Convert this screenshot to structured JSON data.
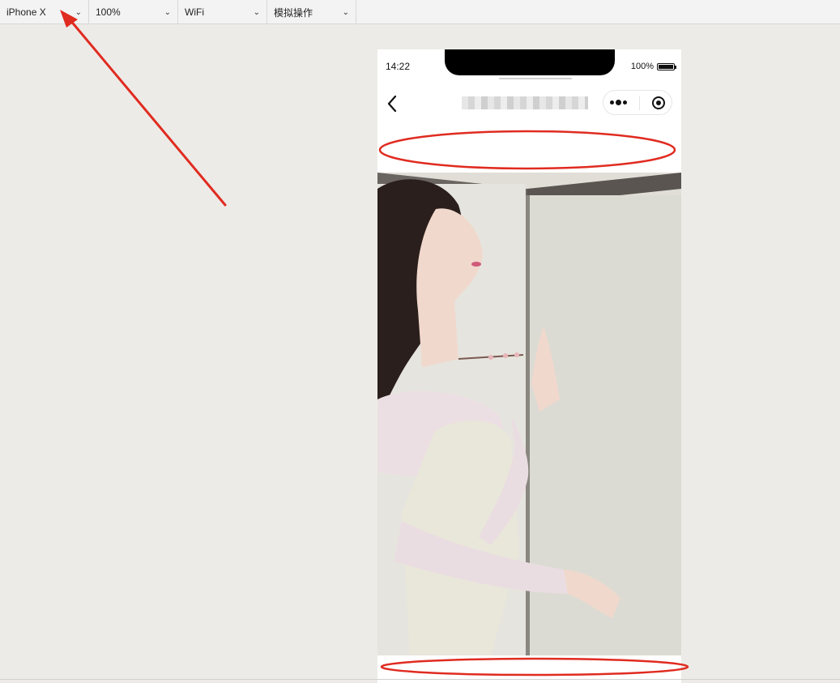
{
  "toolbar": {
    "device": "iPhone X",
    "zoom": "100%",
    "network": "WiFi",
    "operation": "模拟操作"
  },
  "simulator": {
    "status_time": "14:22",
    "battery_percent": "100%"
  },
  "icons": {
    "dropdown": "chevron-down-icon",
    "back": "chevron-left-icon",
    "more": "more-dots-icon",
    "close": "target-circle-icon",
    "battery": "battery-icon"
  },
  "colors": {
    "annotation": "#e02b20",
    "canvas_bg": "#edebe7",
    "toolbar_bg": "#f3f3f3"
  }
}
